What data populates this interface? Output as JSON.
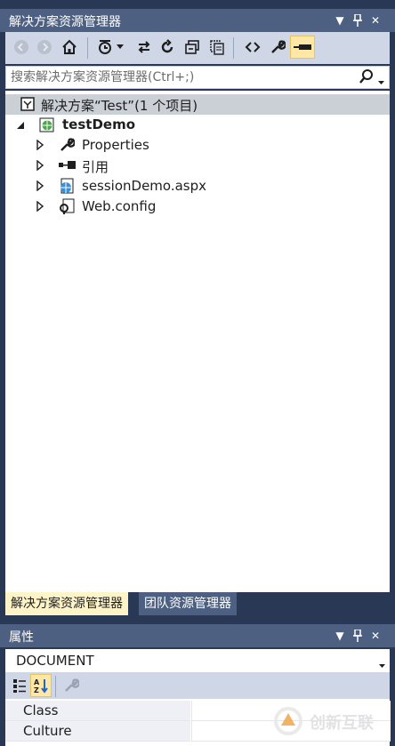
{
  "solution_explorer": {
    "title": "解决方案资源管理器",
    "search_placeholder": "搜索解决方案资源管理器(Ctrl+;)",
    "solution_label": "解决方案“Test”(1 个项目)",
    "project": "testDemo",
    "items": [
      {
        "label": "Properties",
        "icon": "wrench-icon"
      },
      {
        "label": "引用",
        "icon": "references-icon"
      },
      {
        "label": "sessionDemo.aspx",
        "icon": "web-page-icon"
      },
      {
        "label": "Web.config",
        "icon": "config-file-icon"
      }
    ]
  },
  "tabs": [
    {
      "label": "解决方案资源管理器",
      "active": true
    },
    {
      "label": "团队资源管理器",
      "active": false
    }
  ],
  "properties": {
    "title": "属性",
    "selected_object": "DOCUMENT",
    "rows": [
      {
        "name": "Class",
        "value": ""
      },
      {
        "name": "Culture",
        "value": ""
      }
    ]
  },
  "watermark": "创新互联",
  "colors": {
    "frame": "#293955",
    "titlebar": "#4d6082",
    "toolbar": "#cfd6e5",
    "selected_row": "#cbcfd6",
    "active_tab": "#fff4c8",
    "pin_highlight": "#ffe8a6"
  }
}
